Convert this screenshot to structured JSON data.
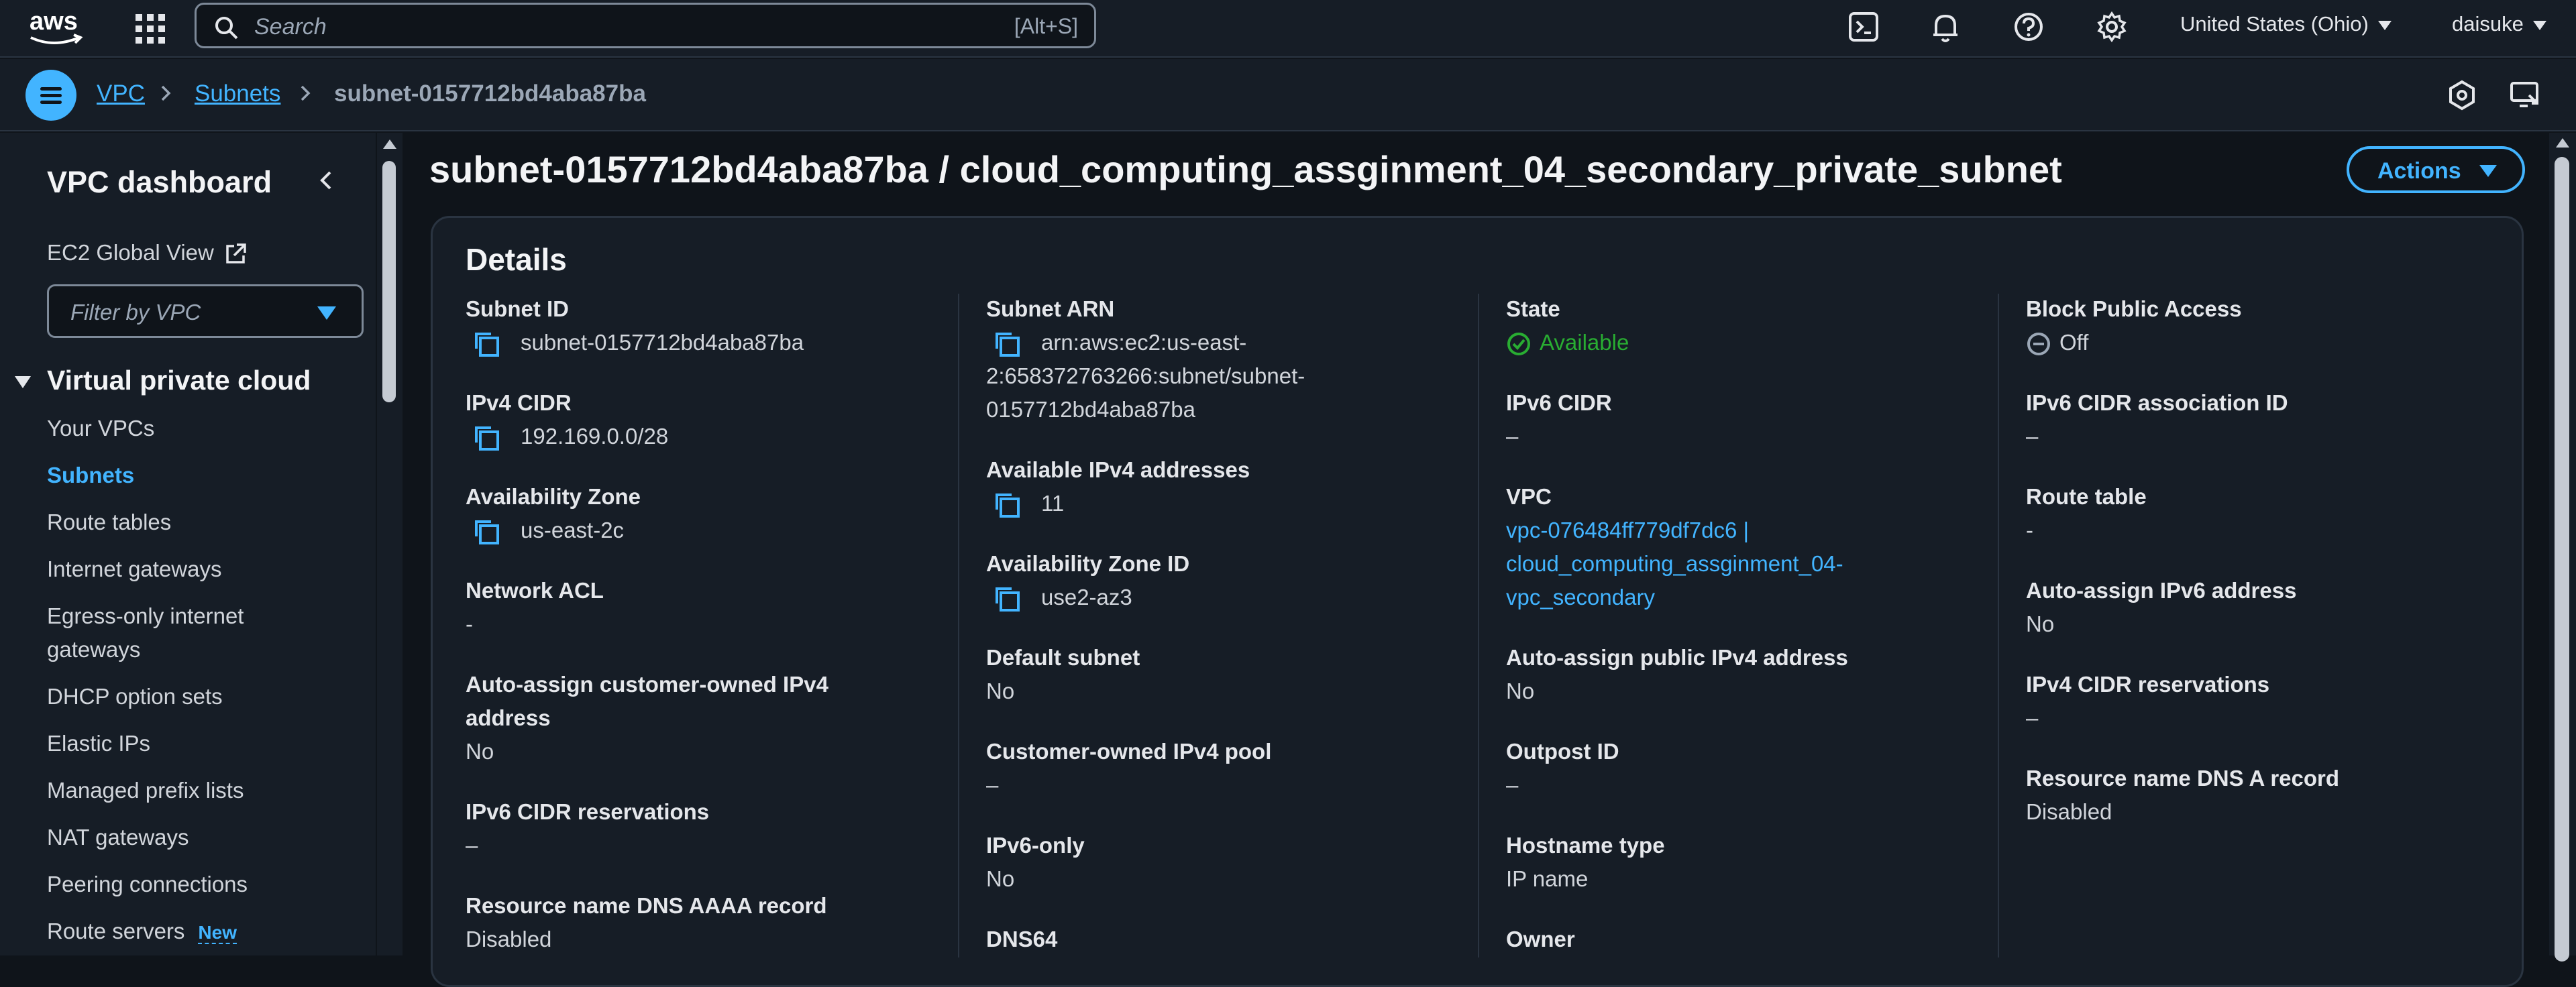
{
  "topbar": {
    "logo": "aws",
    "search_placeholder": "Search",
    "search_shortcut": "[Alt+S]",
    "region": "United States (Ohio)",
    "user": "daisuke",
    "icons": [
      "cloudshell-icon",
      "bell-icon",
      "help-icon",
      "gear-icon"
    ]
  },
  "breadcrumb": {
    "items": [
      "VPC",
      "Subnets"
    ],
    "current": "subnet-0157712bd4aba87ba"
  },
  "sidebar": {
    "title": "VPC dashboard",
    "ec2_global_view": "EC2 Global View",
    "filter_placeholder": "Filter by VPC",
    "section": "Virtual private cloud",
    "items": [
      {
        "label": "Your VPCs"
      },
      {
        "label": "Subnets",
        "active": true
      },
      {
        "label": "Route tables"
      },
      {
        "label": "Internet gateways"
      },
      {
        "label": "Egress-only internet gateways"
      },
      {
        "label": "DHCP option sets"
      },
      {
        "label": "Elastic IPs"
      },
      {
        "label": "Managed prefix lists"
      },
      {
        "label": "NAT gateways"
      },
      {
        "label": "Peering connections"
      },
      {
        "label": "Route servers",
        "badge": "New"
      }
    ]
  },
  "page": {
    "title": "subnet-0157712bd4aba87ba / cloud_computing_assginment_04_secondary_private_subnet",
    "actions_label": "Actions"
  },
  "details": {
    "title": "Details",
    "col1": {
      "subnet_id_label": "Subnet ID",
      "subnet_id": "subnet-0157712bd4aba87ba",
      "ipv4_cidr_label": "IPv4 CIDR",
      "ipv4_cidr": "192.169.0.0/28",
      "az_label": "Availability Zone",
      "az": "us-east-2c",
      "nacl_label": "Network ACL",
      "nacl": "-",
      "auto_assign_co_label": "Auto-assign customer-owned IPv4 address",
      "auto_assign_co": "No",
      "ipv6_res_label": "IPv6 CIDR reservations",
      "ipv6_res": "–",
      "dns_aaaa_label": "Resource name DNS AAAA record",
      "dns_aaaa": "Disabled"
    },
    "col2": {
      "arn_label": "Subnet ARN",
      "arn_line1": "arn:aws:ec2:us-east-",
      "arn_line2": "2:658372763266:subnet/subnet-",
      "arn_line3": "0157712bd4aba87ba",
      "avail_ipv4_label": "Available IPv4 addresses",
      "avail_ipv4": "11",
      "az_id_label": "Availability Zone ID",
      "az_id": "use2-az3",
      "default_label": "Default subnet",
      "default": "No",
      "co_pool_label": "Customer-owned IPv4 pool",
      "co_pool": "–",
      "ipv6_only_label": "IPv6-only",
      "ipv6_only": "No",
      "dns64_label": "DNS64"
    },
    "col3": {
      "state_label": "State",
      "state": "Available",
      "ipv6_cidr_label": "IPv6 CIDR",
      "ipv6_cidr": "–",
      "vpc_label": "VPC",
      "vpc_line1": "vpc-076484ff779df7dc6 |",
      "vpc_line2": "cloud_computing_assginment_04-",
      "vpc_line3": "vpc_secondary",
      "auto_pub_label": "Auto-assign public IPv4 address",
      "auto_pub": "No",
      "outpost_label": "Outpost ID",
      "outpost": "–",
      "hostname_label": "Hostname type",
      "hostname": "IP name",
      "owner_label": "Owner"
    },
    "col4": {
      "bpa_label": "Block Public Access",
      "bpa": "Off",
      "ipv6_assoc_label": "IPv6 CIDR association ID",
      "ipv6_assoc": "–",
      "route_label": "Route table",
      "route": "-",
      "auto_ipv6_label": "Auto-assign IPv6 address",
      "auto_ipv6": "No",
      "ipv4_res_label": "IPv4 CIDR reservations",
      "ipv4_res": "–",
      "dns_a_label": "Resource name DNS A record",
      "dns_a": "Disabled"
    }
  },
  "colors": {
    "accent": "#42b4ff",
    "success": "#29ad32",
    "background": "#0f141a",
    "panel": "#161d26"
  }
}
